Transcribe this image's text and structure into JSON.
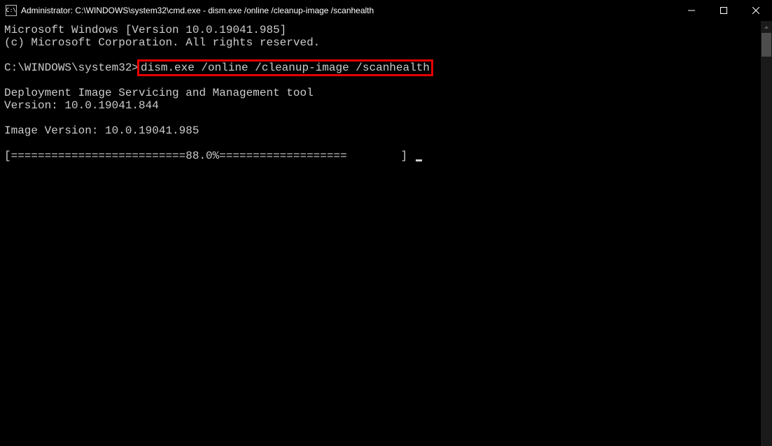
{
  "titlebar": {
    "icon_text": "C:\\",
    "title": "Administrator: C:\\WINDOWS\\system32\\cmd.exe - dism.exe  /online /cleanup-image /scanhealth"
  },
  "terminal": {
    "line1": "Microsoft Windows [Version 10.0.19041.985]",
    "line2": "(c) Microsoft Corporation. All rights reserved.",
    "blank1": "",
    "prompt_prefix": "C:\\WINDOWS\\system32>",
    "command": "dism.exe /online /cleanup-image /scanhealth",
    "blank2": "",
    "tool_line": "Deployment Image Servicing and Management tool",
    "version_line": "Version: 10.0.19041.844",
    "blank3": "",
    "image_version_line": "Image Version: 10.0.19041.985",
    "blank4": "",
    "progress_line": "[==========================88.0%===================        ] "
  }
}
